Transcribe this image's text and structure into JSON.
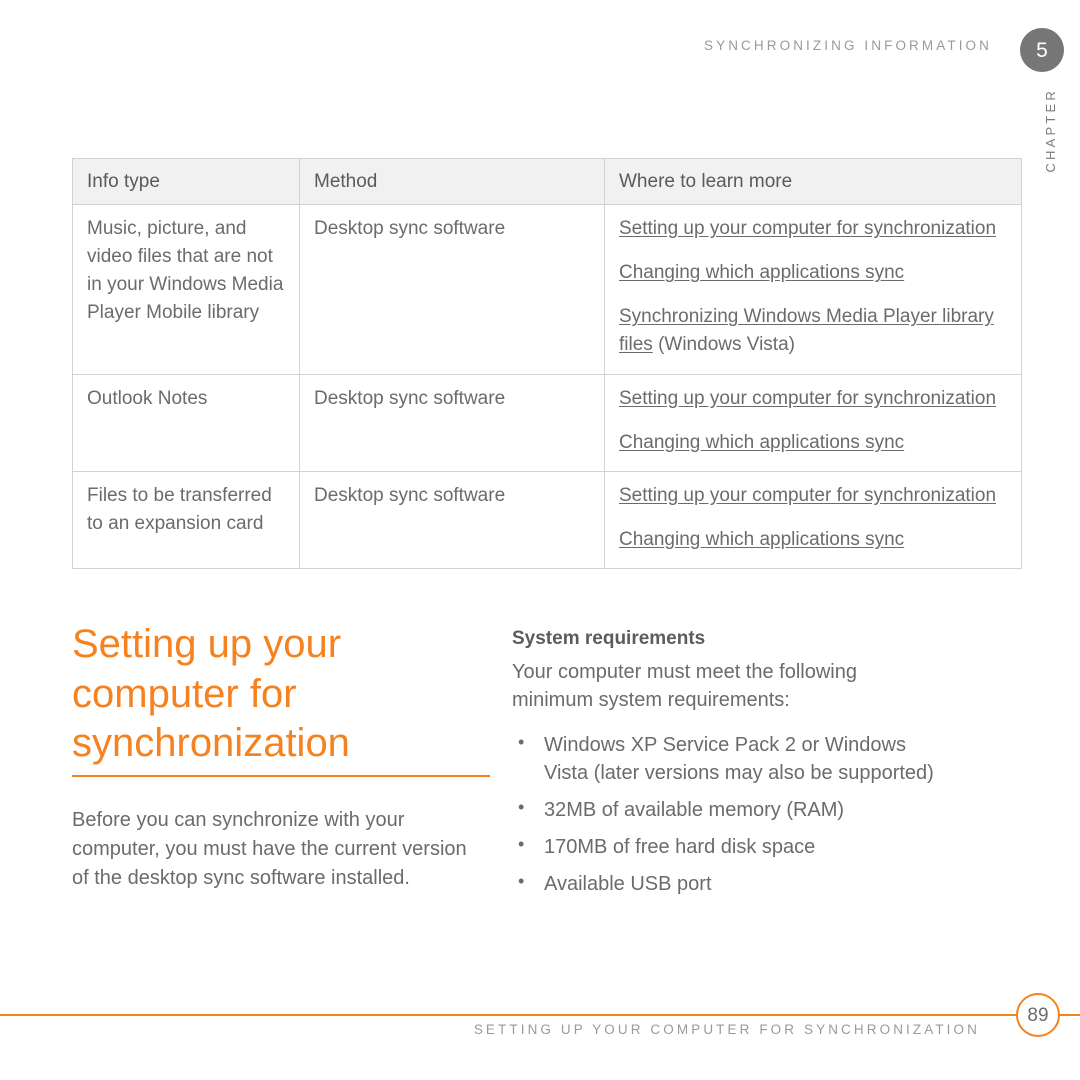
{
  "header": {
    "running_head": "SYNCHRONIZING INFORMATION",
    "chapter_number": "5",
    "chapter_label": "CHAPTER"
  },
  "table": {
    "columns": [
      "Info type",
      "Method",
      "Where to learn more"
    ],
    "rows": [
      {
        "info_type": "Music, picture, and video files that are not in your Windows Media Player Mobile library",
        "method": "Desktop sync software",
        "links": [
          "Setting up your computer for synchronization",
          "Changing which applications sync",
          "Synchronizing Windows Media Player library files"
        ],
        "link_suffix": " (Windows Vista)"
      },
      {
        "info_type": "Outlook Notes",
        "method": "Desktop sync software",
        "links": [
          "Setting up your computer for synchronization",
          "Changing which applications sync"
        ],
        "link_suffix": ""
      },
      {
        "info_type": "Files to be transferred to an expansion card",
        "method": "Desktop sync software",
        "links": [
          "Setting up your computer for synchronization",
          "Changing which applications sync"
        ],
        "link_suffix": ""
      }
    ]
  },
  "section": {
    "heading": "Setting up your computer for synchronization",
    "intro": "Before you can synchronize with your computer, you must have the current version of the desktop sync software installed."
  },
  "requirements": {
    "title": "System requirements",
    "intro": "Your computer must meet the following minimum system requirements:",
    "bullet_glyph": "•",
    "items": [
      "Windows XP Service Pack 2 or Windows Vista (later versions may also be supported)",
      "32MB of available memory (RAM)",
      "170MB of free hard disk space",
      "Available USB port"
    ]
  },
  "footer": {
    "text": "SETTING UP YOUR COMPUTER FOR SYNCHRONIZATION",
    "page_number": "89"
  },
  "colors": {
    "accent_orange": "#F5821F",
    "body_gray": "#6b6b6b",
    "header_row_bg": "#f1f1f1",
    "chapter_badge_bg": "#767676"
  }
}
